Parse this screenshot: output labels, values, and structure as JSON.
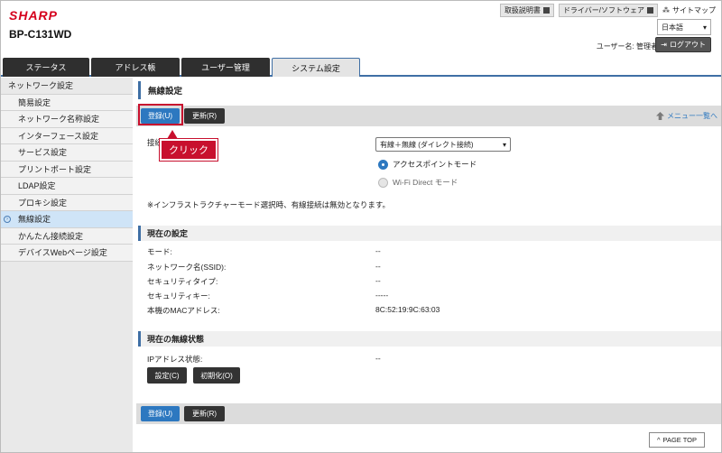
{
  "header": {
    "brand": "SHARP",
    "model": "BP-C131WD",
    "links": [
      "取扱説明書",
      "ドライバー/ソフトウェア"
    ],
    "sitemap": "サイトマップ",
    "language": "日本語",
    "user_label": "ユーザー名: 管理者",
    "logout": "ログアウト"
  },
  "tabs": [
    "ステータス",
    "アドレス帳",
    "ユーザー管理",
    "システム設定"
  ],
  "sidebar": {
    "heading": "ネットワーク設定",
    "items": [
      "簡易設定",
      "ネットワーク名称設定",
      "インターフェース設定",
      "サービス設定",
      "プリントポート設定",
      "LDAP設定",
      "プロキシ設定",
      "無線設定",
      "かんたん接続設定",
      "デバイスWebページ設定"
    ]
  },
  "page": {
    "title": "無線設定",
    "register": "登録(U)",
    "update": "更新(R)",
    "menu_back": "メニュー一覧へ",
    "callout": "クリック",
    "connection_label": "接続",
    "connection_value": "有線＋無線 (ダイレクト接続)",
    "radio_ap": "アクセスポイントモード",
    "radio_wifi": "Wi-Fi Direct モード",
    "note": "※インフラストラクチャーモード選択時、有線接続は無効となります。"
  },
  "current": {
    "title": "現在の設定",
    "rows": [
      {
        "label": "モード:",
        "value": "--"
      },
      {
        "label": "ネットワーク名(SSID):",
        "value": "--"
      },
      {
        "label": "セキュリティタイプ:",
        "value": "--"
      },
      {
        "label": "セキュリティキー:",
        "value": "-----"
      },
      {
        "label": "本機のMACアドレス:",
        "value": "8C:52:19:9C:63:03"
      }
    ]
  },
  "status": {
    "title": "現在の無線状態",
    "ip_label": "IPアドレス状態:",
    "ip_value": "--",
    "settings_btn": "設定(C)",
    "reset_btn": "初期化(O)"
  },
  "footer": {
    "register": "登録(U)",
    "update": "更新(R)",
    "pagetop": "PAGE TOP"
  }
}
